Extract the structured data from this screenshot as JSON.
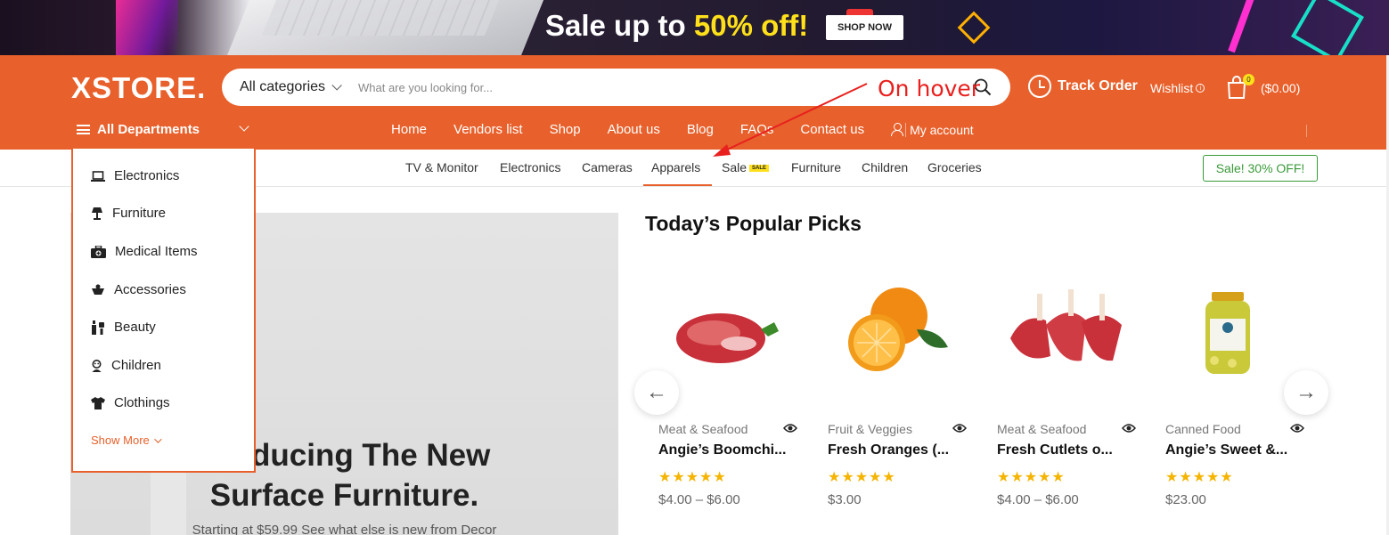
{
  "promo": {
    "text_prefix": "Sale up to ",
    "text_highlight": "50% off!",
    "button": "SHOP NOW"
  },
  "header": {
    "logo": "XSTORE.",
    "search": {
      "category": "All categories",
      "placeholder": "What are you looking for..."
    },
    "track_order": "Track Order",
    "wishlist": "Wishlist",
    "cart": {
      "count": "0",
      "total": "($0.00)"
    }
  },
  "nav": {
    "departments": "All Departments",
    "items": [
      "Home",
      "Vendors list",
      "Shop",
      "About us",
      "Blog",
      "FAQs",
      "Contact us"
    ],
    "my_account": "My account"
  },
  "catbar": {
    "items": [
      "TV & Monitor",
      "Electronics",
      "Cameras",
      "Apparels",
      "Sale",
      "Furniture",
      "Children",
      "Groceries"
    ],
    "sale_tag": "SALE",
    "active": "Apparels",
    "promo_button": "Sale! 30% OFF!"
  },
  "dropdown": {
    "items": [
      {
        "label": "Electronics",
        "icon": "laptop-icon"
      },
      {
        "label": "Furniture",
        "icon": "lamp-icon"
      },
      {
        "label": "Medical Items",
        "icon": "medical-kit-icon"
      },
      {
        "label": "Accessories",
        "icon": "accessories-icon"
      },
      {
        "label": "Beauty",
        "icon": "beauty-icon"
      },
      {
        "label": "Children",
        "icon": "child-icon"
      },
      {
        "label": "Clothings",
        "icon": "shirt-icon"
      }
    ],
    "show_more": "Show More"
  },
  "hero": {
    "title_line1": "oducing The New",
    "title_line2": "Surface Furniture.",
    "subtitle": "Starting at $59.99 See what else is new from Decor"
  },
  "picks": {
    "title": "Today’s Popular Picks",
    "products": [
      {
        "category": "Meat & Seafood",
        "name": "Angie’s Boomchi...",
        "stars": "★★★★★",
        "price": "$4.00 – $6.00"
      },
      {
        "category": "Fruit & Veggies",
        "name": "Fresh Oranges (...",
        "stars": "★★★★★",
        "price": "$3.00"
      },
      {
        "category": "Meat & Seafood",
        "name": "Fresh Cutlets o...",
        "stars": "★★★★★",
        "price": "$4.00 – $6.00"
      },
      {
        "category": "Canned Food",
        "name": "Angie’s Sweet &...",
        "stars": "★★★★★",
        "price": "$23.00"
      }
    ]
  },
  "annotation": {
    "text": "On hover"
  },
  "colors": {
    "brand": "#e8602b",
    "highlight": "#ffe01a",
    "sale_green": "#3a9a3a",
    "annotation": "#e8201e"
  }
}
